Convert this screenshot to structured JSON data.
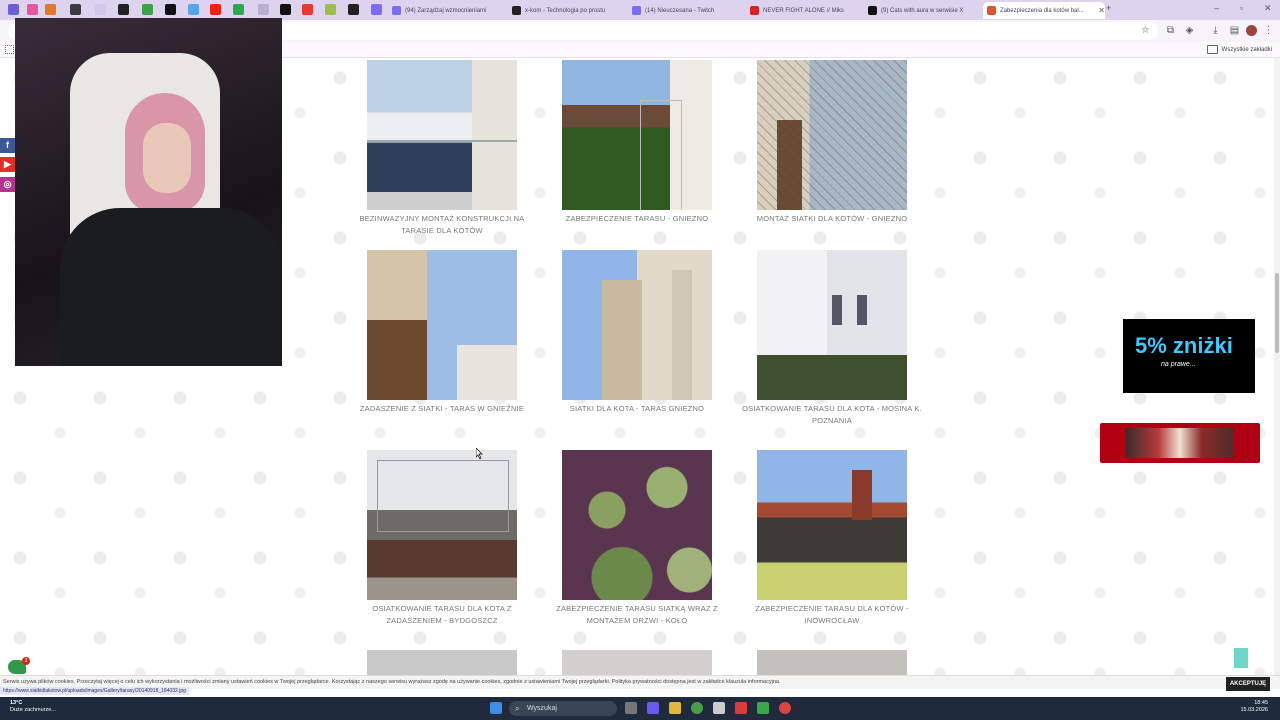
{
  "browser": {
    "tabs": [
      {
        "title": "(94) Zarządzaj wzmocnieniami",
        "icon_color": "#7b6cf6"
      },
      {
        "title": "x-kom - Technologia po prostu",
        "icon_color": "#222222"
      },
      {
        "title": "(14) Nieuczesana - Twitch",
        "icon_color": "#7b6cf6"
      },
      {
        "title": "NEVER FIGHT ALONE // Miks",
        "icon_color": "#e02020"
      },
      {
        "title": "(9) Cats with aura w serwisie X",
        "icon_color": "#111111"
      },
      {
        "title": "Zabezpieczenia dla kotów bal...",
        "icon_color": "#d9582b"
      }
    ],
    "bookmarks_label": "Wszystkie zakładki"
  },
  "gallery": [
    {
      "caption": "BEZINWAZYJNY MONTAŻ KONSTRUKCJI NA TARASIE DLA KOTÓW",
      "scene": "balcony-glass"
    },
    {
      "caption": "ZABEZPIECZENIE TARASU - GNIEZNO",
      "scene": "terrace-trees"
    },
    {
      "caption": "MONTAŻ SIATKI DLA KOTÓW - GNIEZNO",
      "scene": "net-wall"
    },
    {
      "caption": "ZADASZENIE Z SIATKI - TARAS W GNIEŹNIE",
      "scene": "net-roof"
    },
    {
      "caption": "SIATKI DLA KOTA - TARAS GNIEZNO",
      "scene": "facade-sky"
    },
    {
      "caption": "OSIATKOWANIE TARASU DLA KOTA - MOSINA K. POZNANIA",
      "scene": "white-house"
    },
    {
      "caption": "OSIATKOWANIE TARASU DLA KOTA Z ZADASZENIEM - BYDGOSZCZ",
      "scene": "grey-roof"
    },
    {
      "caption": "ZABEZPIECZENIE TARASU SIATKĄ WRAZ Z MONTAŻEM DRZWI - KOŁO",
      "scene": "ivy"
    },
    {
      "caption": "ZABEZPIECZENIE TARASU DLA KOTÓW - INOWROCŁAW",
      "scene": "chimney"
    }
  ],
  "promo": {
    "big": "5% zniżki",
    "small": "na prawe..."
  },
  "social": [
    "f",
    "yt",
    "ig"
  ],
  "cookie": {
    "text": "Serwis używa plików cookies. Przeczytaj więcej o celu ich wykorzystania i możliwości zmiany ustawień cookies w Twojej przeglądarce. Korzystając z naszego serwisu wyrażasz zgodę na używanie cookies, zgodnie z ustawieniami Twojej przeglądarki. Polityka prywatności dostępna jest w zakładce klauzula informacyjna.",
    "accept": "AKCEPTUJĘ"
  },
  "status_url": "https://www.siatkidlakotow.pl/uploads/images/Gallery/tarasy/20140918_184032.jpg",
  "taskbar": {
    "weather_temp": "13°C",
    "weather_desc": "Duże zachmurze...",
    "search": "Wyszukaj",
    "time": "18:45",
    "date": "15.03.2026"
  },
  "chat_badge": "3"
}
